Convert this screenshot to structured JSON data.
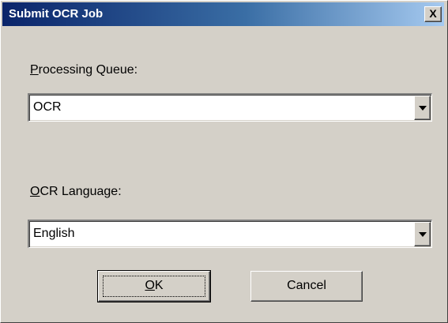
{
  "window": {
    "title": "Submit OCR Job",
    "close_label": "X"
  },
  "processing_queue": {
    "label_mnemonic": "P",
    "label_rest": "rocessing Queue:",
    "value": "OCR"
  },
  "ocr_language": {
    "label_mnemonic": "O",
    "label_rest": "CR Language:",
    "value": "English"
  },
  "buttons": {
    "ok_mnemonic": "O",
    "ok_rest": "K",
    "cancel_label": "Cancel"
  },
  "icons": {
    "close": "close-icon",
    "dropdown": "chevron-down-icon"
  },
  "colors": {
    "titlebar_start": "#0a246a",
    "titlebar_end": "#a6caf0",
    "dialog_face": "#d4d0c8"
  }
}
